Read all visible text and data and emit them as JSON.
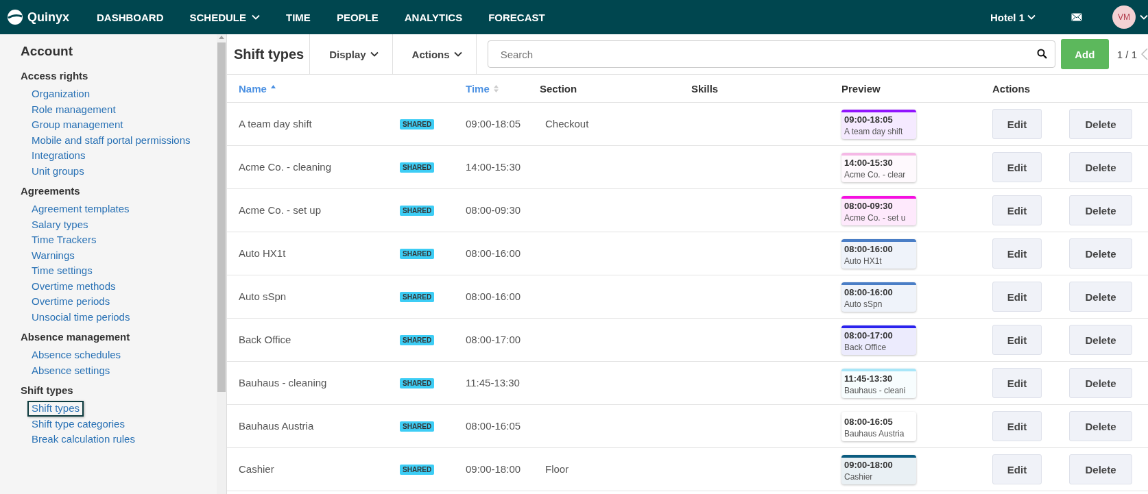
{
  "topbar": {
    "logo": "Quinyx",
    "nav": [
      {
        "label": "DASHBOARD",
        "dropdown": false
      },
      {
        "label": "SCHEDULE",
        "dropdown": true
      },
      {
        "label": "TIME",
        "dropdown": false
      },
      {
        "label": "PEOPLE",
        "dropdown": false
      },
      {
        "label": "ANALYTICS",
        "dropdown": false
      },
      {
        "label": "FORECAST",
        "dropdown": false
      }
    ],
    "unit": "Hotel 1",
    "avatar": "VM"
  },
  "sidebar": {
    "title": "Account",
    "groups": [
      {
        "heading": "Access rights",
        "items": [
          {
            "label": "Organization",
            "selected": false
          },
          {
            "label": "Role management",
            "selected": false
          },
          {
            "label": "Group management",
            "selected": false
          },
          {
            "label": "Mobile and staff portal permissions",
            "selected": false
          },
          {
            "label": "Integrations",
            "selected": false
          },
          {
            "label": "Unit groups",
            "selected": false
          }
        ]
      },
      {
        "heading": "Agreements",
        "items": [
          {
            "label": "Agreement templates",
            "selected": false
          },
          {
            "label": "Salary types",
            "selected": false
          },
          {
            "label": "Time Trackers",
            "selected": false
          },
          {
            "label": "Warnings",
            "selected": false
          },
          {
            "label": "Time settings",
            "selected": false
          },
          {
            "label": "Overtime methods",
            "selected": false
          },
          {
            "label": "Overtime periods",
            "selected": false
          },
          {
            "label": "Unsocial time periods",
            "selected": false
          }
        ]
      },
      {
        "heading": "Absence management",
        "items": [
          {
            "label": "Absence schedules",
            "selected": false
          },
          {
            "label": "Absence settings",
            "selected": false
          }
        ]
      },
      {
        "heading": "Shift types",
        "items": [
          {
            "label": "Shift types",
            "selected": true
          },
          {
            "label": "Shift type categories",
            "selected": false
          },
          {
            "label": "Break calculation rules",
            "selected": false
          }
        ]
      }
    ]
  },
  "toolbar": {
    "title": "Shift types",
    "menus": [
      "Display",
      "Actions"
    ],
    "search": {
      "placeholder": "Search"
    },
    "add_button": "Add",
    "pagination": "1 / 1"
  },
  "table": {
    "columns": [
      {
        "label": "Name",
        "sortable": true,
        "sorted": true
      },
      {
        "label": "Time",
        "sortable": true,
        "sorted": false
      },
      {
        "label": "Section",
        "sortable": false,
        "sorted": false
      },
      {
        "label": "Skills",
        "sortable": false,
        "sorted": false
      },
      {
        "label": "Preview",
        "sortable": false,
        "sorted": false
      },
      {
        "label": "Actions",
        "sortable": false,
        "sorted": false
      }
    ],
    "rows": [
      {
        "name": "A team day shift",
        "badge": "SHARED",
        "time": "09:00-18:05",
        "section": "Checkout",
        "preview": {
          "time": "09:00-18:05",
          "name": "A team day shift",
          "color": "#9013fe"
        },
        "edit": "Edit",
        "delete": "Delete"
      },
      {
        "name": "Acme Co. - cleaning",
        "badge": "SHARED",
        "time": "14:00-15:30",
        "preview": {
          "time": "14:00-15:30",
          "name": "Acme Co. - clear",
          "color": "#f5b8e6"
        },
        "edit": "Edit",
        "delete": "Delete"
      },
      {
        "name": "Acme Co. - set up",
        "badge": "SHARED",
        "time": "08:00-09:30",
        "preview": {
          "time": "08:00-09:30",
          "name": "Acme Co. - set u",
          "color": "#f50fe0"
        },
        "edit": "Edit",
        "delete": "Delete"
      },
      {
        "name": "Auto HX1t",
        "badge": "SHARED",
        "time": "08:00-16:00",
        "preview": {
          "time": "08:00-16:00",
          "name": "Auto HX1t",
          "color": "#4a7ec6"
        },
        "edit": "Edit",
        "delete": "Delete"
      },
      {
        "name": "Auto sSpn",
        "badge": "SHARED",
        "time": "08:00-16:00",
        "preview": {
          "time": "08:00-16:00",
          "name": "Auto sSpn",
          "color": "#4a7ec6"
        },
        "edit": "Edit",
        "delete": "Delete"
      },
      {
        "name": "Back Office",
        "badge": "SHARED",
        "time": "08:00-17:00",
        "preview": {
          "time": "08:00-17:00",
          "name": "Back Office",
          "color": "#2a22ee"
        },
        "edit": "Edit",
        "delete": "Delete"
      },
      {
        "name": "Bauhaus - cleaning",
        "badge": "SHARED",
        "time": "11:45-13:30",
        "preview": {
          "time": "11:45-13:30",
          "name": "Bauhaus - cleani",
          "color": "#a8e6f8"
        },
        "edit": "Edit",
        "delete": "Delete"
      },
      {
        "name": "Bauhaus Austria",
        "badge": "SHARED",
        "time": "08:00-16:05",
        "preview": {
          "time": "08:00-16:05",
          "name": "Bauhaus Austria"
        },
        "edit": "Edit",
        "delete": "Delete"
      },
      {
        "name": "Cashier",
        "badge": "SHARED",
        "time": "09:00-18:00",
        "section": "Floor",
        "preview": {
          "time": "09:00-18:00",
          "name": "Cashier",
          "color": "#0b5c80"
        },
        "edit": "Edit",
        "delete": "Delete"
      }
    ]
  }
}
